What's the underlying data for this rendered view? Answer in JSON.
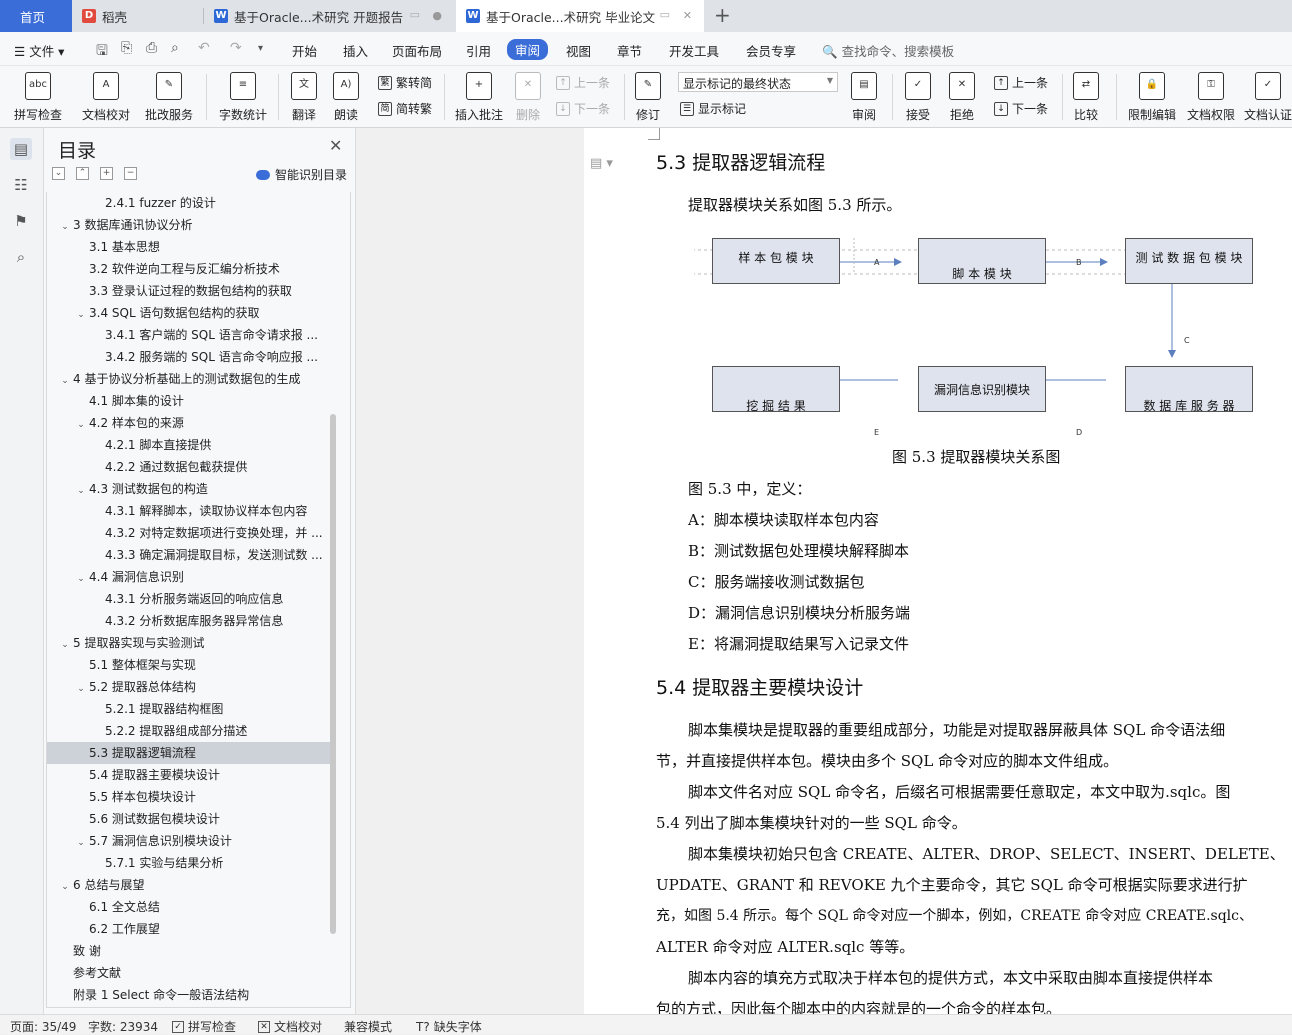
{
  "tabs": {
    "home": "首页",
    "t1": "稻壳",
    "t2": "基于Oracle...术研究 开题报告",
    "t3": "基于Oracle...术研究 毕业论文"
  },
  "menu": {
    "file": "文件",
    "items": [
      "开始",
      "插入",
      "页面布局",
      "引用",
      "审阅",
      "视图",
      "章节",
      "开发工具",
      "会员专享"
    ],
    "search": "查找命令、搜索模板"
  },
  "ribbon": {
    "spellcheck": "拼写检查",
    "doccheck": "文档校对",
    "batch": "批改服务",
    "wordcount": "字数统计",
    "translate": "翻译",
    "read": "朗读",
    "to_trad": "繁转简",
    "to_simp": "简转繁",
    "insert_comment": "插入批注",
    "delete": "删除",
    "prev": "上一条",
    "next": "下一条",
    "track": "修订",
    "markup_select": "显示标记的最终状态",
    "show_markup": "显示标记",
    "review": "审阅",
    "accept": "接受",
    "reject": "拒绝",
    "prev2": "上一条",
    "next2": "下一条",
    "compare": "比较",
    "restrict": "限制编辑",
    "permission": "文档权限",
    "certify": "文档认证"
  },
  "toc": {
    "title": "目录",
    "smart": "智能识别目录",
    "items": [
      {
        "label": "2.4.1 fuzzer 的设计",
        "level": 3,
        "chev": ""
      },
      {
        "label": "3 数据库通讯协议分析",
        "level": 1,
        "chev": "v"
      },
      {
        "label": "3.1 基本思想",
        "level": 2,
        "chev": ""
      },
      {
        "label": "3.2 软件逆向工程与反汇编分析技术",
        "level": 2,
        "chev": ""
      },
      {
        "label": "3.3 登录认证过程的数据包结构的获取",
        "level": 2,
        "chev": ""
      },
      {
        "label": "3.4 SQL 语句数据包结构的获取",
        "level": 2,
        "chev": "v"
      },
      {
        "label": "3.4.1 客户端的 SQL 语言命令请求报 ...",
        "level": 3,
        "chev": ""
      },
      {
        "label": "3.4.2 服务端的 SQL 语言命令响应报 ...",
        "level": 3,
        "chev": ""
      },
      {
        "label": "4 基于协议分析基础上的测试数据包的生成",
        "level": 1,
        "chev": "v"
      },
      {
        "label": "4.1 脚本集的设计",
        "level": 2,
        "chev": ""
      },
      {
        "label": "4.2 样本包的来源",
        "level": 2,
        "chev": "v"
      },
      {
        "label": "4.2.1 脚本直接提供",
        "level": 3,
        "chev": ""
      },
      {
        "label": "4.2.2 通过数据包截获提供",
        "level": 3,
        "chev": ""
      },
      {
        "label": "4.3 测试数据包的构造",
        "level": 2,
        "chev": "v"
      },
      {
        "label": "4.3.1 解释脚本，读取协议样本包内容",
        "level": 3,
        "chev": ""
      },
      {
        "label": "4.3.2 对特定数据项进行变换处理，并 ...",
        "level": 3,
        "chev": ""
      },
      {
        "label": "4.3.3 确定漏洞提取目标，发送测试数 ...",
        "level": 3,
        "chev": ""
      },
      {
        "label": "4.4 漏洞信息识别",
        "level": 2,
        "chev": "v"
      },
      {
        "label": "4.3.1 分析服务端返回的响应信息",
        "level": 3,
        "chev": ""
      },
      {
        "label": "4.3.2 分析数据库服务器异常信息",
        "level": 3,
        "chev": ""
      },
      {
        "label": "5 提取器实现与实验测试",
        "level": 1,
        "chev": "v"
      },
      {
        "label": "5.1 整体框架与实现",
        "level": 2,
        "chev": ""
      },
      {
        "label": "5.2 提取器总体结构",
        "level": 2,
        "chev": "v"
      },
      {
        "label": "5.2.1 提取器结构框图",
        "level": 3,
        "chev": ""
      },
      {
        "label": "5.2.2 提取器组成部分描述",
        "level": 3,
        "chev": ""
      },
      {
        "label": "5.3 提取器逻辑流程",
        "level": 2,
        "chev": "",
        "active": true
      },
      {
        "label": "5.4 提取器主要模块设计",
        "level": 2,
        "chev": ""
      },
      {
        "label": "5.5 样本包模块设计",
        "level": 2,
        "chev": ""
      },
      {
        "label": "5.6 测试数据包模块设计",
        "level": 2,
        "chev": ""
      },
      {
        "label": "5.7 漏洞信息识别模块设计",
        "level": 2,
        "chev": "v"
      },
      {
        "label": "5.7.1 实验与结果分析",
        "level": 3,
        "chev": ""
      },
      {
        "label": "6 总结与展望",
        "level": 1,
        "chev": "v"
      },
      {
        "label": "6.1 全文总结",
        "level": 2,
        "chev": ""
      },
      {
        "label": "6.2 工作展望",
        "level": 2,
        "chev": ""
      },
      {
        "label": "致 谢",
        "level": 1,
        "chev": ""
      },
      {
        "label": "参考文献",
        "level": 1,
        "chev": ""
      },
      {
        "label": "附录 1 Select 命令一般语法结构",
        "level": 1,
        "chev": ""
      }
    ]
  },
  "doc": {
    "h53": "5.3 提取器逻辑流程",
    "p_intro": "提取器模块关系如图 5.3 所示。",
    "fig": {
      "sample": "样 本 包 模 块",
      "script": "脚 本 模 块",
      "testpkt": "测 试 数 据 包 模 块",
      "mining": "挖 掘 结 果",
      "vuln": "漏洞信息识别模块",
      "dbserver": "数 据 库 服 务 器",
      "a": "A",
      "b": "B",
      "c": "C",
      "d": "D",
      "e": "E"
    },
    "caption": "图 5.3  提取器模块关系图",
    "def_intro": "图 5.3 中，定义：",
    "defs": [
      "A：脚本模块读取样本包内容",
      "B：测试数据包处理模块解释脚本",
      "C：服务端接收测试数据包",
      "D：漏洞信息识别模块分析服务端",
      "E：将漏洞提取结果写入记录文件"
    ],
    "h54": "5.4 提取器主要模块设计",
    "lines": [
      "脚本集模块是提取器的重要组成部分，功能是对提取器屏蔽具体 SQL 命令语法细",
      "节，并直接提供样本包。模块由多个 SQL 命令对应的脚本文件组成。",
      "脚本文件名对应 SQL 命令名，后缀名可根据需要任意取定，本文中取为.sqlc。图",
      "5.4 列出了脚本集模块针对的一些 SQL 命令。",
      "脚本集模块初始只包含 CREATE、ALTER、DROP、SELECT、INSERT、DELETE、",
      "UPDATE、GRANT 和 REVOKE 九个主要命令，其它 SQL 命令可根据实际要求进行扩",
      "充，如图 5.4 所示。每个 SQL 命令对应一个脚本，例如，CREATE 命令对应 CREATE.sqlc、",
      "ALTER 命令对应 ALTER.sqlc 等等。",
      "脚本内容的填充方式取决于样本包的提供方式，本文中采取由脚本直接提供样本",
      "包的方式，因此每个脚本中的内容就是的一个命令的样本包。"
    ]
  },
  "status": {
    "page": "页面: 35/49",
    "words": "字数: 23934",
    "spell": "拼写检查",
    "proof": "文档校对",
    "compat": "兼容模式",
    "missing_font": "缺失字体"
  }
}
